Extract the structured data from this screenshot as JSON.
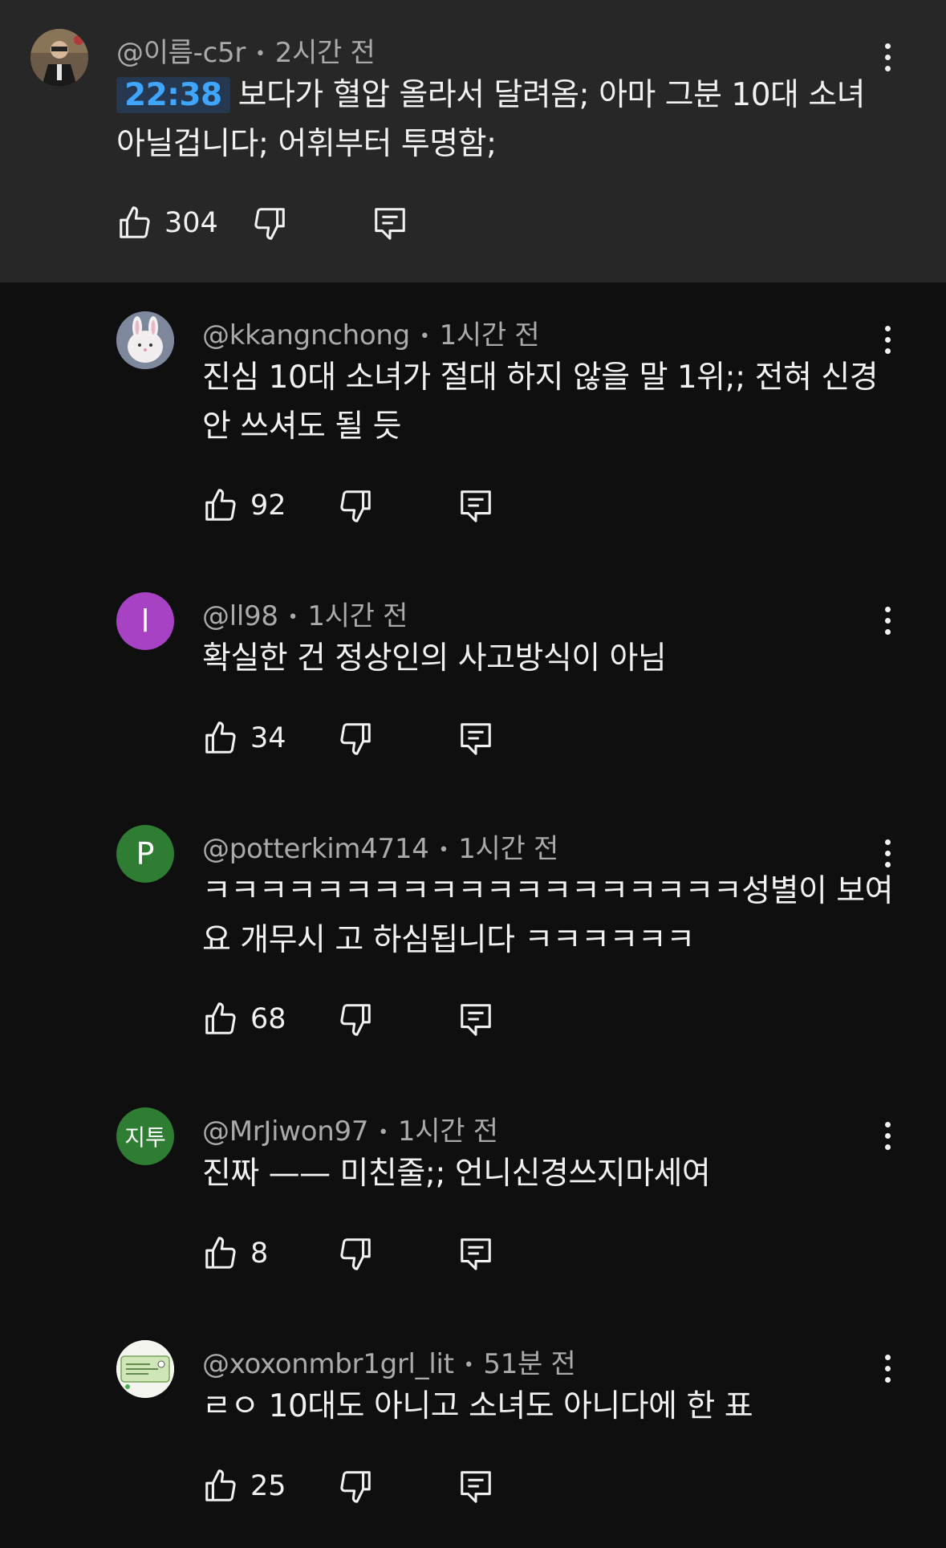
{
  "comments": [
    {
      "author": "@이름-c5r",
      "time": "2시간 전",
      "timestamp_link": "22:38",
      "text": "보다가 혈압 올라서 달려옴; 아마 그분 10대 소녀 아닐겁니다; 어휘부터 투명함;",
      "likes": "304",
      "avatar_letter": "",
      "avatar_color": "#5a4a3a",
      "highlighted": true
    },
    {
      "author": "@kkangnchong",
      "time": "1시간 전",
      "text": "진심 10대 소녀가 절대 하지 않을 말 1위;; 전혀 신경 안 쓰셔도 될 듯",
      "likes": "92",
      "avatar_letter": "",
      "avatar_color": "#8a93a6"
    },
    {
      "author": "@ll98",
      "time": "1시간 전",
      "text": "확실한 건 정상인의 사고방식이 아님",
      "likes": "34",
      "avatar_letter": "l",
      "avatar_color": "#a842c4"
    },
    {
      "author": "@potterkim4714",
      "time": "1시간 전",
      "text": "ㅋㅋㅋㅋㅋㅋㅋㅋㅋㅋㅋㅋㅋㅋㅋㅋㅋㅋㅋ성별이 보여요 개무시 고 하심됩니다 ㅋㅋㅋㅋㅋㅋ",
      "likes": "68",
      "avatar_letter": "P",
      "avatar_color": "#2e7d32"
    },
    {
      "author": "@MrJiwon97",
      "time": "1시간 전",
      "text": "진짜 —— 미친줄;; 언니신경쓰지마세여",
      "likes": "8",
      "avatar_letter": "지투",
      "avatar_color": "#2e7d32"
    },
    {
      "author": "@xoxonmbr1grl_lit",
      "time": "51분 전",
      "text": "ㄹㅇ 10대도 아니고 소녀도 아니다에 한 표",
      "likes": "25",
      "avatar_letter": "",
      "avatar_color": "#e8efe3"
    }
  ],
  "icons": {
    "like": "thumbs-up-icon",
    "dislike": "thumbs-down-icon",
    "reply": "reply-icon",
    "menu": "more-vert-icon"
  },
  "colors": {
    "background": "#0f0f0f",
    "highlight": "#272727",
    "timestamp_link": "#3ea6ff"
  }
}
